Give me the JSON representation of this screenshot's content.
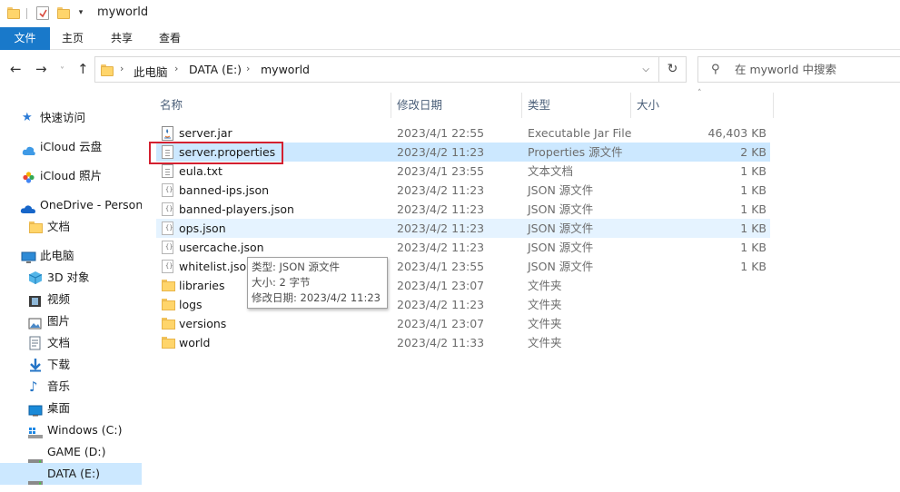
{
  "window": {
    "title": "myworld"
  },
  "ribbon": {
    "file": "文件",
    "tabs": [
      "主页",
      "共享",
      "查看"
    ]
  },
  "address": {
    "crumbs": [
      "此电脑",
      "DATA (E:)",
      "myworld"
    ]
  },
  "search": {
    "placeholder": "在 myworld 中搜索"
  },
  "sidebar": {
    "items": [
      {
        "label": "快速访问",
        "icon": "star-icon"
      },
      {
        "label": "iCloud 云盘",
        "icon": "icloud-icon"
      },
      {
        "label": "iCloud 照片",
        "icon": "icloud-photos-icon"
      },
      {
        "label": "OneDrive - Persona",
        "icon": "onedrive-icon"
      },
      {
        "label": "文档",
        "icon": "folder-icon"
      },
      {
        "label": "此电脑",
        "icon": "computer-icon"
      },
      {
        "label": "3D 对象",
        "icon": "3d-objects-icon"
      },
      {
        "label": "视频",
        "icon": "video-icon"
      },
      {
        "label": "图片",
        "icon": "pictures-icon"
      },
      {
        "label": "文档",
        "icon": "documents-icon"
      },
      {
        "label": "下载",
        "icon": "download-icon"
      },
      {
        "label": "音乐",
        "icon": "music-icon"
      },
      {
        "label": "桌面",
        "icon": "desktop-icon"
      },
      {
        "label": "Windows (C:)",
        "icon": "windows-drive-icon"
      },
      {
        "label": "GAME (D:)",
        "icon": "drive-icon"
      },
      {
        "label": "DATA (E:)",
        "icon": "drive-icon",
        "selected": true
      }
    ]
  },
  "columns": {
    "name": "名称",
    "date": "修改日期",
    "type": "类型",
    "size": "大小"
  },
  "files": [
    {
      "name": "server.jar",
      "date": "2023/4/1 22:55",
      "type": "Executable Jar File",
      "size": "46,403 KB",
      "icon": "jar-icon"
    },
    {
      "name": "server.properties",
      "date": "2023/4/2 11:23",
      "type": "Properties 源文件",
      "size": "2 KB",
      "icon": "properties-file-icon",
      "selected": true
    },
    {
      "name": "eula.txt",
      "date": "2023/4/1 23:55",
      "type": "文本文档",
      "size": "1 KB",
      "icon": "text-file-icon"
    },
    {
      "name": "banned-ips.json",
      "date": "2023/4/2 11:23",
      "type": "JSON 源文件",
      "size": "1 KB",
      "icon": "json-file-icon"
    },
    {
      "name": "banned-players.json",
      "date": "2023/4/2 11:23",
      "type": "JSON 源文件",
      "size": "1 KB",
      "icon": "json-file-icon"
    },
    {
      "name": "ops.json",
      "date": "2023/4/2 11:23",
      "type": "JSON 源文件",
      "size": "1 KB",
      "icon": "json-file-icon",
      "hover": true
    },
    {
      "name": "usercache.json",
      "date": "2023/4/2 11:23",
      "type": "JSON 源文件",
      "size": "1 KB",
      "icon": "json-file-icon"
    },
    {
      "name": "whitelist.json",
      "date": "2023/4/1 23:55",
      "type": "JSON 源文件",
      "size": "1 KB",
      "icon": "json-file-icon"
    },
    {
      "name": "libraries",
      "date": "2023/4/1 23:07",
      "type": "文件夹",
      "size": "",
      "icon": "folder-icon"
    },
    {
      "name": "logs",
      "date": "2023/4/2 11:23",
      "type": "文件夹",
      "size": "",
      "icon": "folder-icon"
    },
    {
      "name": "versions",
      "date": "2023/4/1 23:07",
      "type": "文件夹",
      "size": "",
      "icon": "folder-icon"
    },
    {
      "name": "world",
      "date": "2023/4/2 11:33",
      "type": "文件夹",
      "size": "",
      "icon": "folder-icon"
    }
  ],
  "tooltip": {
    "type_line": "类型: JSON 源文件",
    "size_line": "大小: 2 字节",
    "date_line": "修改日期: 2023/4/2 11:23"
  },
  "colors": {
    "accent": "#1979ca",
    "selection": "#cce8ff",
    "hover": "#e5f3ff",
    "highlight_box": "#d32030"
  }
}
